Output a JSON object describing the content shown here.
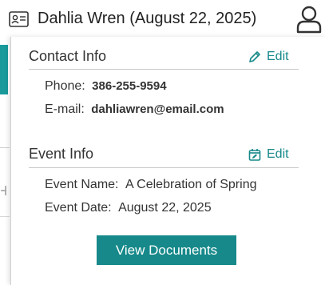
{
  "header": {
    "contact_name": "Dahlia Wren (August 22, 2025)",
    "left_icon": "contact-card-icon",
    "right_icon": "user-icon"
  },
  "contact_info": {
    "title": "Contact Info",
    "edit_label": "Edit",
    "edit_icon": "pencil-icon",
    "phone_label": "Phone:",
    "phone_value": "386-255-9594",
    "email_label": "E-mail:",
    "email_value": "dahliawren@email.com"
  },
  "event_info": {
    "title": "Event Info",
    "edit_label": "Edit",
    "edit_icon": "calendar-edit-icon",
    "name_label": "Event Name:",
    "name_value": "A Celebration of Spring",
    "date_label": "Event Date:",
    "date_value": "August 22, 2025"
  },
  "actions": {
    "view_documents_label": "View Documents"
  },
  "colors": {
    "accent": "#17898a",
    "text": "#333333",
    "rule": "#c8c8c8"
  }
}
